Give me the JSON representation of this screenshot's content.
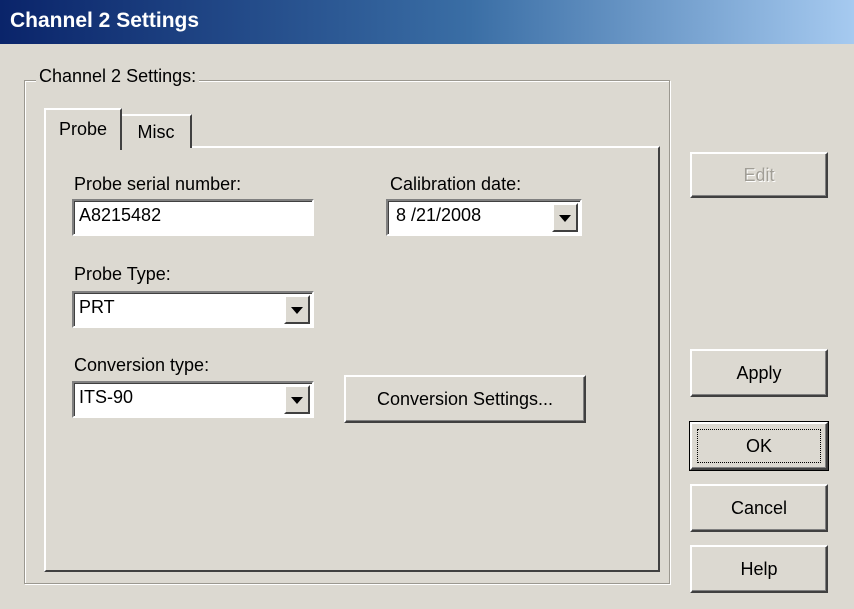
{
  "window": {
    "title": "Channel 2 Settings"
  },
  "group": {
    "label": "Channel 2 Settings:"
  },
  "tabs": [
    {
      "label": "Probe",
      "active": true
    },
    {
      "label": "Misc",
      "active": false
    }
  ],
  "probe": {
    "serial_label": "Probe serial number:",
    "serial_value": "A8215482",
    "calibration_label": "Calibration date:",
    "calibration_value": "8 /21/2008",
    "type_label": "Probe Type:",
    "type_value": "PRT",
    "conversion_label": "Conversion type:",
    "conversion_value": "ITS-90",
    "conversion_settings_label": "Conversion Settings..."
  },
  "buttons": {
    "edit": {
      "label": "Edit",
      "enabled": false
    },
    "apply": {
      "label": "Apply"
    },
    "ok": {
      "label": "OK"
    },
    "cancel": {
      "label": "Cancel"
    },
    "help": {
      "label": "Help"
    }
  },
  "colors": {
    "titlebar_start": "#0a246a",
    "titlebar_end": "#a6caf0",
    "face": "#dcd9d1"
  }
}
